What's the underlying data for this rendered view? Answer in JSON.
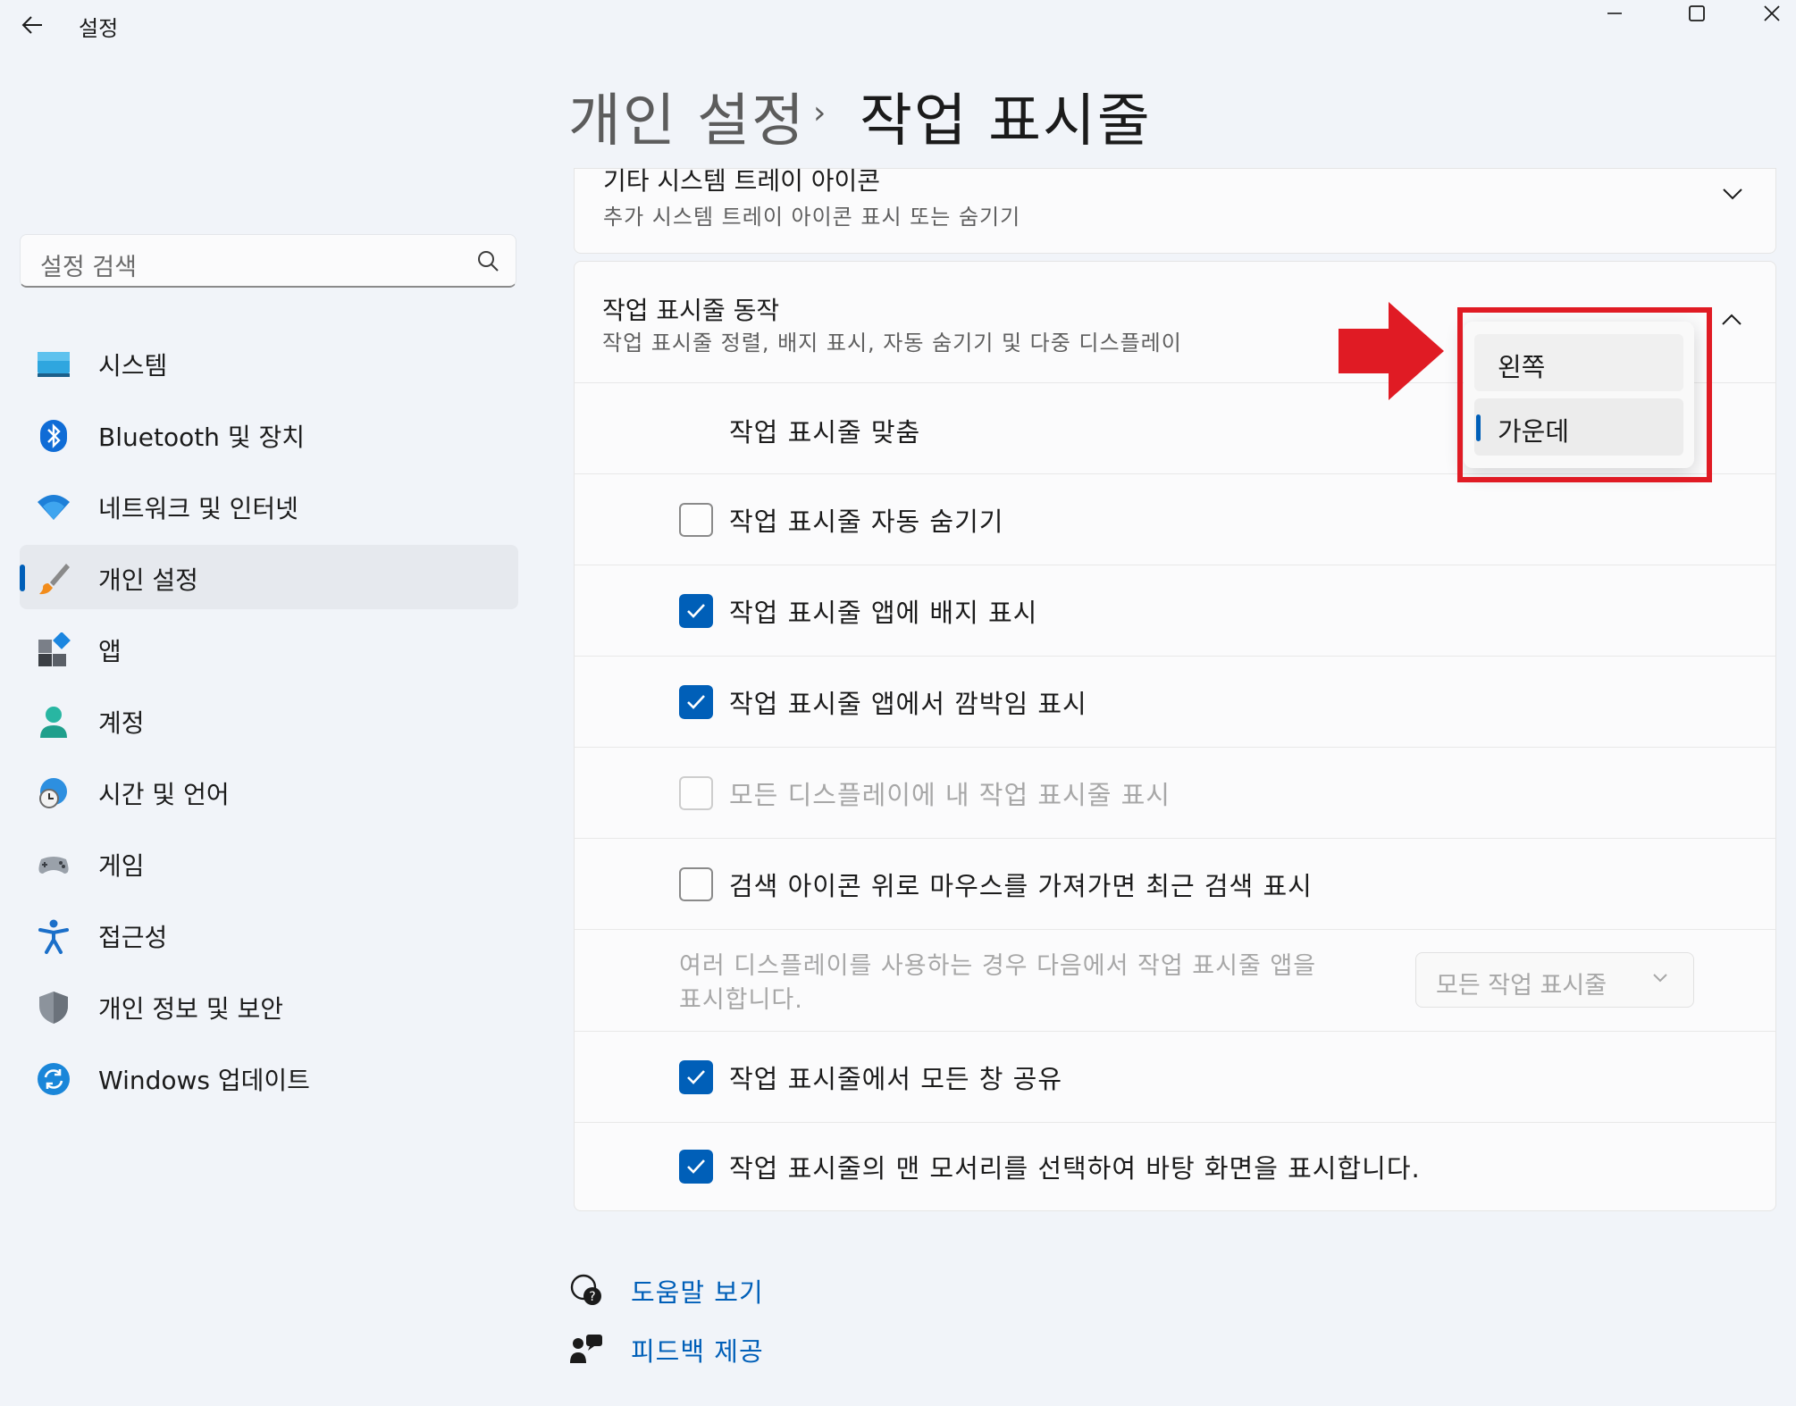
{
  "window": {
    "title": "설정",
    "controls": [
      "minimize",
      "maximize",
      "close"
    ]
  },
  "header": {
    "breadcrumb_parent": "개인 설정",
    "breadcrumb_separator": "›",
    "breadcrumb_current": "작업 표시줄"
  },
  "search": {
    "placeholder": "설정 검색",
    "icon": "search-icon"
  },
  "sidebar": {
    "items": [
      {
        "label": "시스템",
        "icon": "monitor-icon"
      },
      {
        "label": "Bluetooth 및 장치",
        "icon": "bluetooth-icon"
      },
      {
        "label": "네트워크 및 인터넷",
        "icon": "wifi-icon"
      },
      {
        "label": "개인 설정",
        "icon": "paintbrush-icon",
        "selected": true
      },
      {
        "label": "앱",
        "icon": "apps-icon"
      },
      {
        "label": "계정",
        "icon": "person-icon"
      },
      {
        "label": "시간 및 언어",
        "icon": "globe-clock-icon"
      },
      {
        "label": "게임",
        "icon": "gamepad-icon"
      },
      {
        "label": "접근성",
        "icon": "accessibility-icon"
      },
      {
        "label": "개인 정보 및 보안",
        "icon": "shield-icon"
      },
      {
        "label": "Windows 업데이트",
        "icon": "update-icon"
      }
    ]
  },
  "sections": {
    "tray": {
      "title": "기타 시스템 트레이 아이콘",
      "subtitle": "추가 시스템 트레이 아이콘 표시 또는 숨기기",
      "expanded": false
    },
    "behaviors": {
      "title": "작업 표시줄 동작",
      "subtitle": "작업 표시줄 정렬, 배지 표시, 자동 숨기기 및 다중 디스플레이",
      "expanded": true,
      "alignment_label": "작업 표시줄 맞춤",
      "alignment_options": [
        "왼쪽",
        "가운데"
      ],
      "alignment_selected": "가운데",
      "options": [
        {
          "label": "작업 표시줄 자동 숨기기",
          "checked": false,
          "disabled": false
        },
        {
          "label": "작업 표시줄 앱에 배지 표시",
          "checked": true,
          "disabled": false
        },
        {
          "label": "작업 표시줄 앱에서 깜박임 표시",
          "checked": true,
          "disabled": false
        },
        {
          "label": "모든 디스플레이에 내 작업 표시줄 표시",
          "checked": false,
          "disabled": true
        },
        {
          "label": "검색 아이콘 위로 마우스를 가져가면 최근 검색 표시",
          "checked": false,
          "disabled": false
        }
      ],
      "multi_display": {
        "label_line1": "여러 디스플레이를 사용하는 경우 다음에서 작업 표시줄 앱을",
        "label_line2": "표시합니다.",
        "value": "모든 작업 표시줄",
        "disabled": true
      },
      "options_after": [
        {
          "label": "작업 표시줄에서 모든 창 공유",
          "checked": true,
          "disabled": false
        },
        {
          "label": "작업 표시줄의 맨 모서리를 선택하여 바탕 화면을 표시합니다.",
          "checked": true,
          "disabled": false
        }
      ]
    }
  },
  "footer": {
    "help": "도움말 보기",
    "feedback": "피드백 제공"
  },
  "colors": {
    "accent": "#005fb8",
    "annotation_red": "#e01b24",
    "background": "#f1f4f9",
    "card": "#fbfbfc"
  }
}
